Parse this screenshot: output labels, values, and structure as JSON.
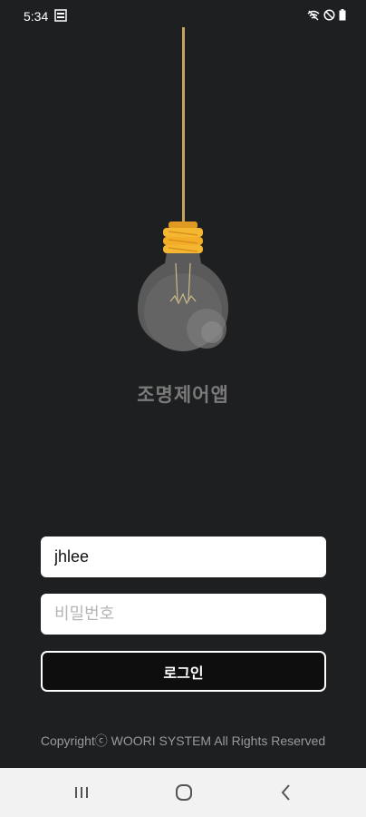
{
  "status_bar": {
    "time": "5:34",
    "icons": [
      "sim-card-icon",
      "wifi-icon",
      "do-not-disturb-icon",
      "battery-icon"
    ]
  },
  "app": {
    "title": "조명제어앱",
    "illustration": "light-bulb-icon"
  },
  "login_form": {
    "id_value": "jhlee",
    "password_placeholder": "비밀번호",
    "login_label": "로그인"
  },
  "footer": {
    "copyright": "Copyrightⓒ WOORI SYSTEM All Rights Reserved"
  },
  "nav_bar": {
    "icons": [
      "recent-apps-icon",
      "home-icon",
      "back-icon"
    ]
  },
  "colors": {
    "background": "#1e1f21",
    "bulb_cap": "#f5b731",
    "bulb_glass": "#5c5c5c",
    "cord": "#c8a45a"
  }
}
